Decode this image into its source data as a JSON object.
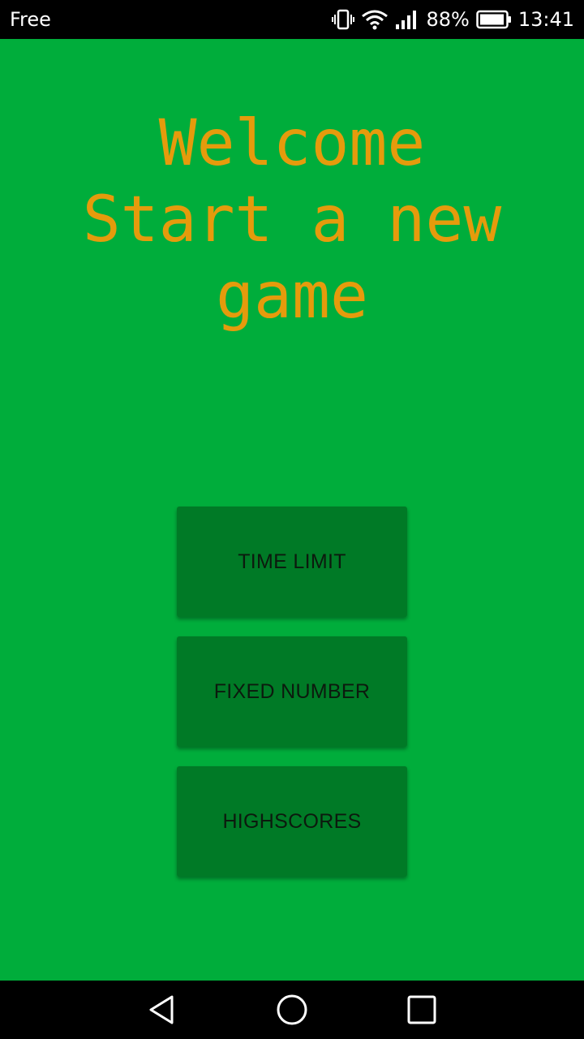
{
  "status_bar": {
    "carrier": "Free",
    "battery_percent": "88%",
    "time": "13:41",
    "icons": [
      "vibrate-icon",
      "wifi-icon",
      "signal-icon",
      "battery-icon"
    ]
  },
  "main": {
    "title_lines": [
      "Welcome",
      "Start a new",
      "game"
    ],
    "buttons": [
      {
        "label": "TIME LIMIT"
      },
      {
        "label": "FIXED NUMBER"
      },
      {
        "label": "HIGHSCORES"
      }
    ]
  },
  "nav_bar": {
    "icons": [
      "back-icon",
      "home-icon",
      "recents-icon"
    ]
  },
  "colors": {
    "background": "#00ad3b",
    "title": "#e59b0c",
    "button": "#007a26",
    "button_text": "#0c1a0e"
  }
}
